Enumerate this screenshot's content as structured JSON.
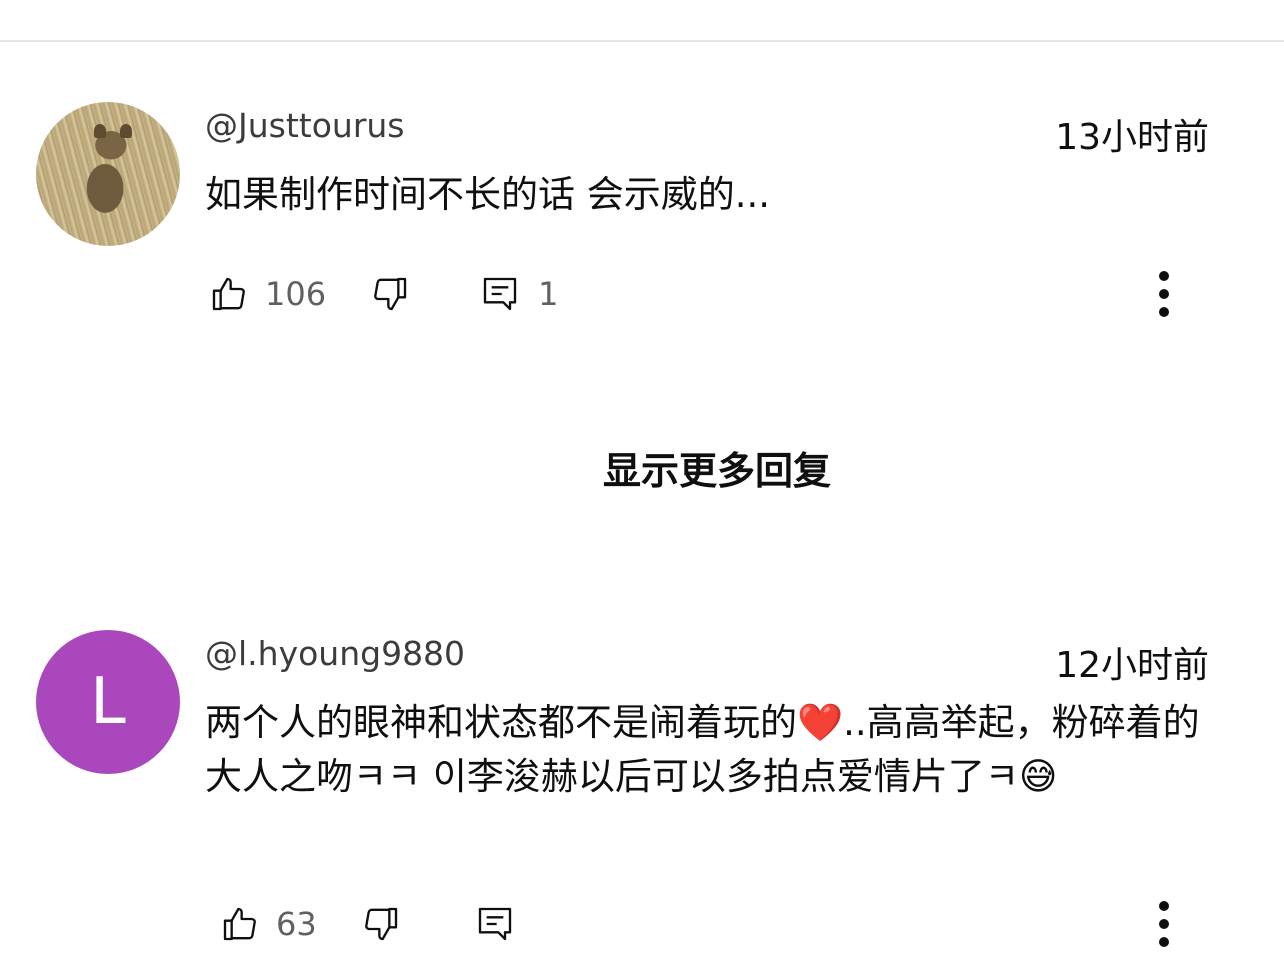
{
  "comments": [
    {
      "author": "@Justtourus",
      "time": "13小时前",
      "text": "如果制作时间不长的话 会示威的...",
      "likes": "106",
      "replies": "1",
      "avatar": {
        "type": "photo"
      }
    },
    {
      "author": "@l.hyoung9880",
      "time": "12小时前",
      "text": "两个人的眼神和状态都不是闹着玩的❤️..高高举起，粉碎着的大人之吻ㅋㅋ 이李浚赫以后可以多拍点爱情片了ㅋ😅",
      "likes": "63",
      "replies": "",
      "avatar": {
        "type": "letter",
        "letter": "L",
        "color": "#ab47bc"
      }
    }
  ],
  "show_more_replies": "显示更多回复",
  "icons": {
    "like": "thumbs-up-icon",
    "dislike": "thumbs-down-icon",
    "reply": "reply-comment-icon",
    "more": "more-vertical-icon"
  }
}
